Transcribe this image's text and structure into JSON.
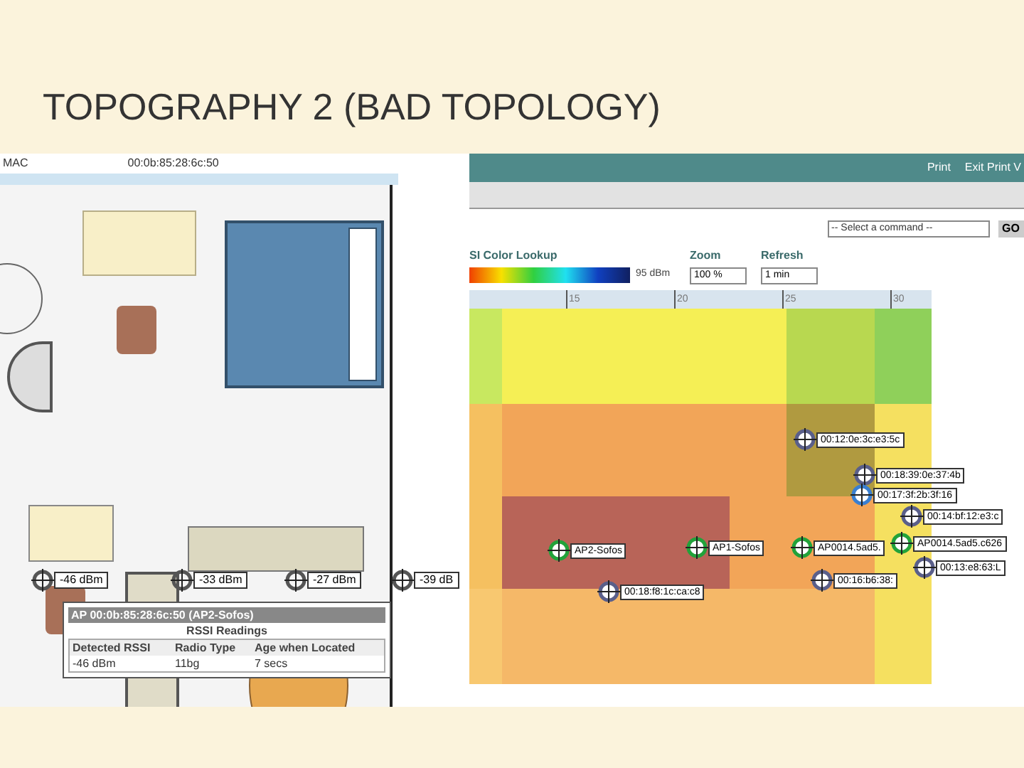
{
  "slide": {
    "title": "TOPOGRAPHY 2 (BAD TOPOLOGY)"
  },
  "left_screenshot": {
    "mac_label": "MAC",
    "mac_value": "00:0b:85:28:6c:50",
    "readings": [
      "-46 dBm",
      "-33 dBm",
      "-27 dBm",
      "-39 dB"
    ],
    "popup": {
      "title": "AP 00:0b:85:28:6c:50 (AP2-Sofos)",
      "subtitle": "RSSI Readings",
      "columns": [
        "Detected RSSI",
        "Radio Type",
        "Age when Located"
      ],
      "row": [
        "-46 dBm",
        "11bg",
        "7 secs"
      ]
    }
  },
  "right_screenshot": {
    "header_links": [
      "Print",
      "Exit Print V"
    ],
    "command_select": {
      "value": "-- Select a command --"
    },
    "go_button": "GO",
    "color_lookup_label": "SI Color Lookup",
    "color_lookup_min": "95 dBm",
    "zoom": {
      "label": "Zoom",
      "value": "100 %"
    },
    "refresh": {
      "label": "Refresh",
      "value": "1 min"
    },
    "ruler_ticks": [
      "15",
      "20",
      "25",
      "30"
    ],
    "markers": [
      {
        "kind": "client",
        "label": "00:12:0e:3c:e3:5c"
      },
      {
        "kind": "client",
        "label": "00:18:39:0e:37:4b"
      },
      {
        "kind": "tag",
        "label": "00:17:3f:2b:3f:16"
      },
      {
        "kind": "client",
        "label": "00:14:bf:12:e3:c"
      },
      {
        "kind": "ap",
        "label": "AP2-Sofos"
      },
      {
        "kind": "ap",
        "label": "AP1-Sofos"
      },
      {
        "kind": "ap",
        "label": "AP0014.5ad5."
      },
      {
        "kind": "ap",
        "label": "AP0014.5ad5.c626"
      },
      {
        "kind": "client",
        "label": "00:13:e8:63:L"
      },
      {
        "kind": "client",
        "label": "00:16:b6:38:"
      },
      {
        "kind": "client",
        "label": "00:18:f8:1c:ca:c8"
      }
    ]
  }
}
